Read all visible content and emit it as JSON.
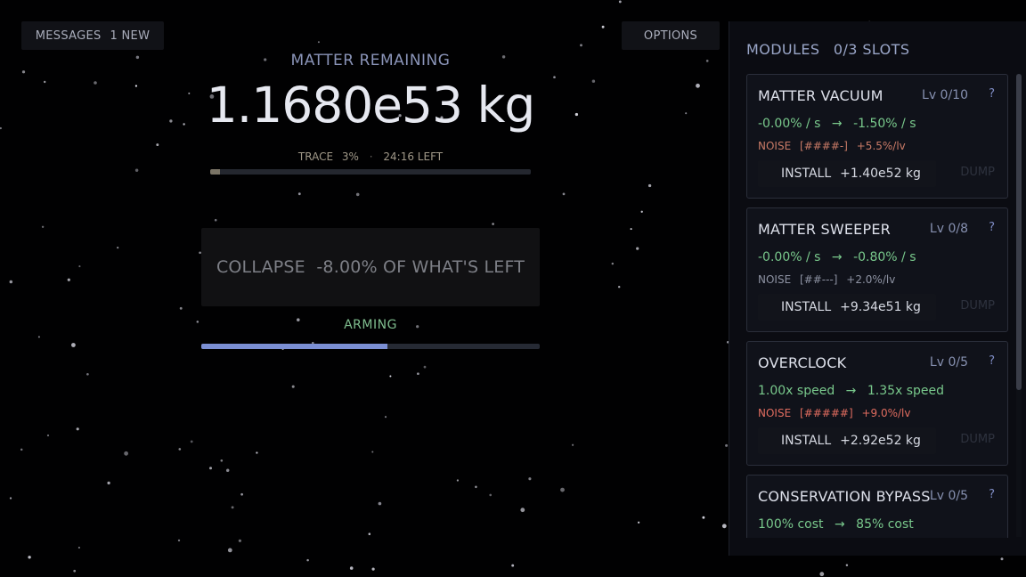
{
  "header": {
    "messages_label": "MESSAGES",
    "messages_count": "1 NEW",
    "options_label": "OPTIONS"
  },
  "matter": {
    "title": "MATTER REMAINING",
    "value": "1.1680e53 kg",
    "trace_label": "TRACE",
    "trace_pct": "3%",
    "trace_sep": "·",
    "time_left": "24:16 LEFT",
    "trace_fraction": 0.03
  },
  "collapse": {
    "label": "COLLAPSE  -8.00% OF WHAT'S LEFT",
    "status": "ARMING",
    "arming_fraction": 0.55
  },
  "modules": {
    "title": "MODULES",
    "slots": "0/3 SLOTS",
    "items": [
      {
        "name": "MATTER VACUUM",
        "level": "Lv 0/10",
        "help": "?",
        "effect_from": "-0.00% / s",
        "arrow": "→",
        "effect_to": "-1.50% / s",
        "noise_label": "NOISE",
        "noise_meter": "[####-]",
        "noise_rate": "+5.5%/lv",
        "noise_severity": "mid",
        "install_label": "INSTALL",
        "install_cost": "+1.40e52 kg",
        "dump_label": "DUMP"
      },
      {
        "name": "MATTER SWEEPER",
        "level": "Lv 0/8",
        "help": "?",
        "effect_from": "-0.00% / s",
        "arrow": "→",
        "effect_to": "-0.80% / s",
        "noise_label": "NOISE",
        "noise_meter": "[##---]",
        "noise_rate": "+2.0%/lv",
        "noise_severity": "low",
        "install_label": "INSTALL",
        "install_cost": "+9.34e51 kg",
        "dump_label": "DUMP"
      },
      {
        "name": "OVERCLOCK",
        "level": "Lv 0/5",
        "help": "?",
        "effect_from": "1.00x speed",
        "arrow": "→",
        "effect_to": "1.35x speed",
        "noise_label": "NOISE",
        "noise_meter": "[#####]",
        "noise_rate": "+9.0%/lv",
        "noise_severity": "high",
        "install_label": "INSTALL",
        "install_cost": "+2.92e52 kg",
        "dump_label": "DUMP"
      },
      {
        "name": "CONSERVATION BYPASS",
        "level": "Lv 0/5",
        "help": "?",
        "effect_from": "100% cost",
        "arrow": "→",
        "effect_to": "85% cost"
      }
    ]
  },
  "colors": {
    "background": "#010102",
    "accent_green": "#79c98c",
    "accent_blue": "#7b8fd4",
    "noise_high": "#e06c5f",
    "noise_low": "#8d92a2"
  }
}
